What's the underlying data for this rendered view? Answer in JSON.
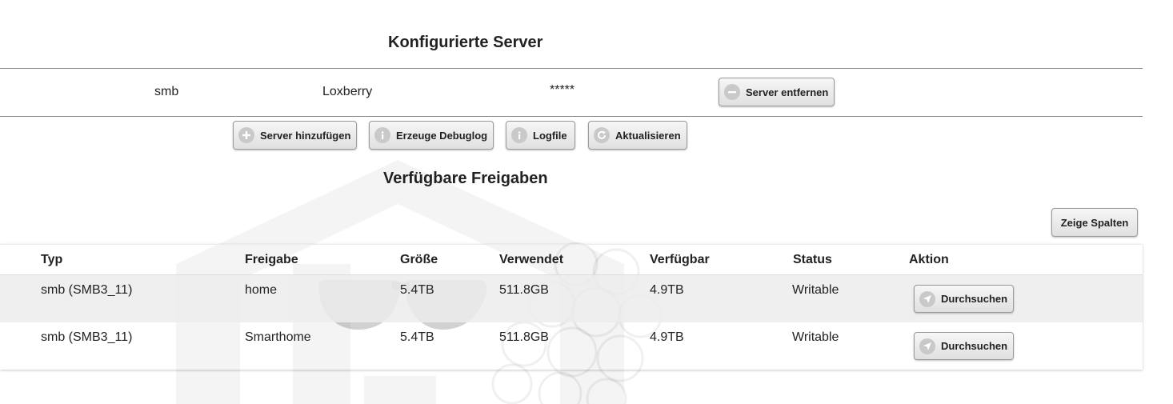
{
  "configured_servers": {
    "title": "Konfigurierte Server",
    "rows": [
      {
        "type": "smb",
        "name": "Loxberry",
        "password": "*****",
        "remove_label": "Server entfernen"
      }
    ]
  },
  "actions": {
    "add_server": "Server hinzufügen",
    "debuglog": "Erzeuge Debuglog",
    "logfile": "Logfile",
    "refresh": "Aktualisieren"
  },
  "shares": {
    "title": "Verfügbare Freigaben",
    "show_columns_label": "Zeige Spalten",
    "columns": [
      "Typ",
      "Freigabe",
      "Größe",
      "Verwendet",
      "Verfügbar",
      "Status",
      "Aktion"
    ],
    "rows": [
      {
        "typ": "smb (SMB3_11)",
        "freigabe": "home",
        "groesse": "5.4TB",
        "verwendet": "511.8GB",
        "verfuegbar": "4.9TB",
        "status": "Writable",
        "aktion": "Durchsuchen"
      },
      {
        "typ": "smb (SMB3_11)",
        "freigabe": "Smarthome",
        "groesse": "5.4TB",
        "verwendet": "511.8GB",
        "verfuegbar": "4.9TB",
        "status": "Writable",
        "aktion": "Durchsuchen"
      }
    ]
  },
  "icons": {
    "remove": "minus-circle-icon",
    "add": "plus-circle-icon",
    "info": "info-circle-icon",
    "refresh": "refresh-icon",
    "browse": "navigation-arrow-icon"
  },
  "colors": {
    "button_bg": "#e8e8e8",
    "icon_circle": "#c9c9c9",
    "row_alt": "#ececec",
    "divider": "#8a8a8a"
  }
}
